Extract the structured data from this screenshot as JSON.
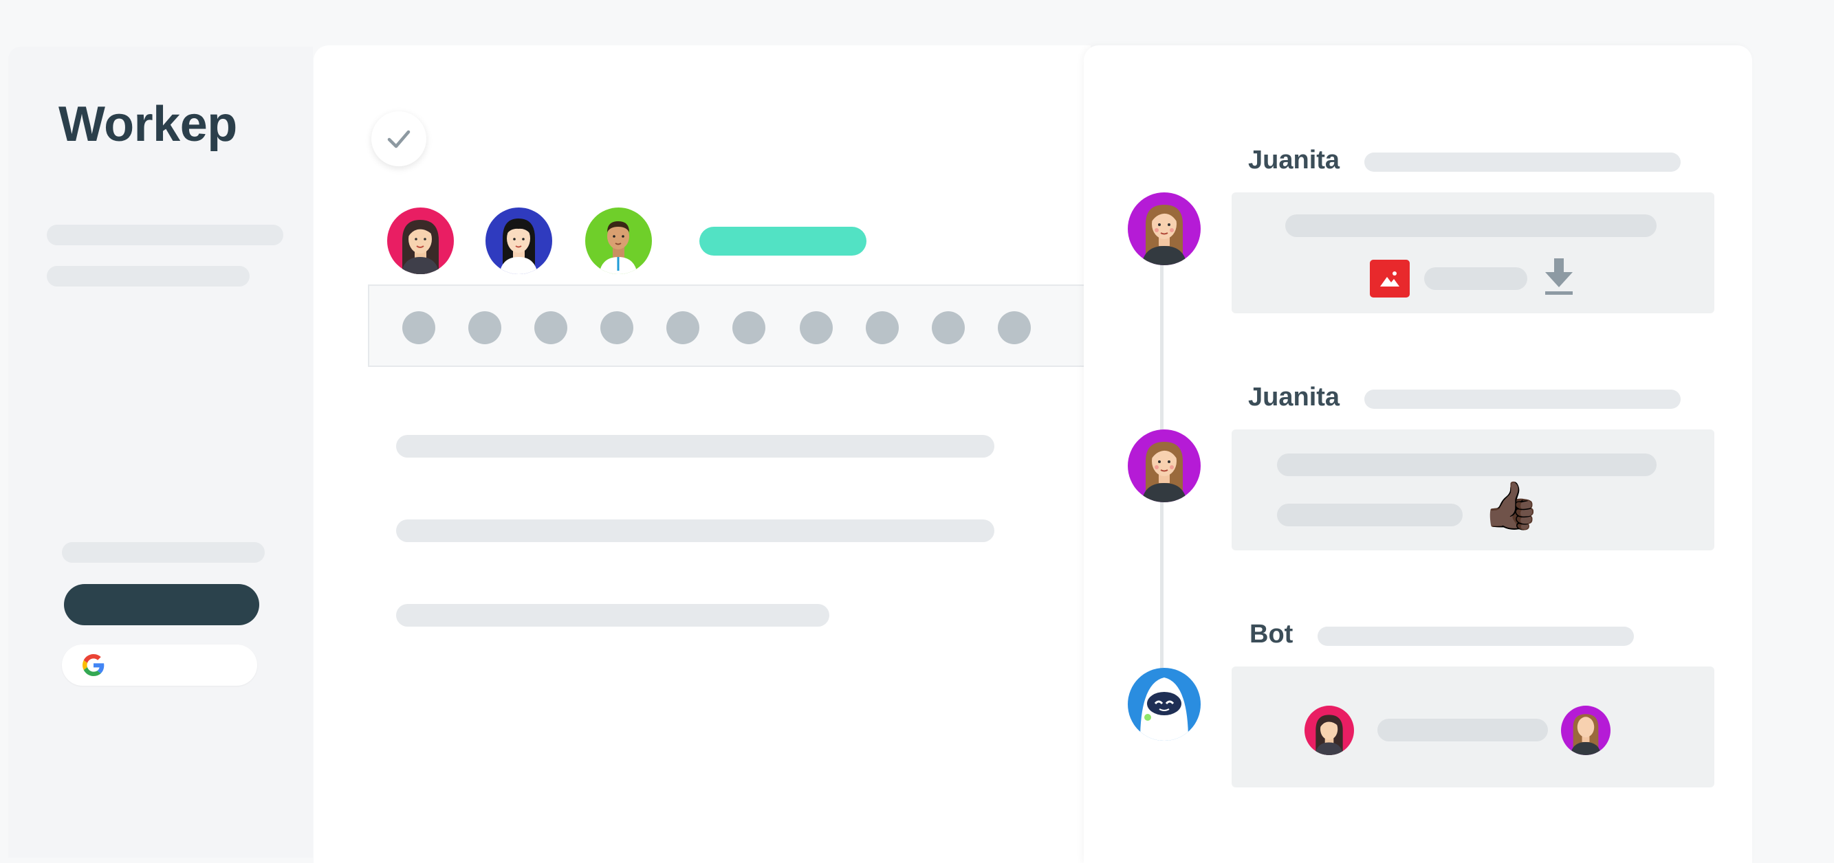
{
  "brand": {
    "name": "Workep"
  },
  "sidebar": {
    "signin_button_label": "",
    "google_button_label": ""
  },
  "task": {
    "check_icon": "check-icon",
    "assignees": [
      {
        "name": "",
        "color": "#e91e63"
      },
      {
        "name": "",
        "color": "#2f3bbf"
      },
      {
        "name": "",
        "color": "#6fcf2a"
      }
    ],
    "status_color": "#52e2c4",
    "step_dot_count": 10
  },
  "activity": {
    "messages": [
      {
        "author": "Juanita",
        "attachment_icon": "image-icon",
        "action_icon": "download-icon"
      },
      {
        "author": "Juanita",
        "reaction": "👍🏿"
      },
      {
        "author": "Bot",
        "avatar_color": "#2a8de0"
      }
    ]
  },
  "colors": {
    "brand_dark": "#2b424c",
    "accent_teal": "#52e2c4",
    "juanita_avatar": "#b51bd6",
    "image_icon_red": "#e8292c"
  }
}
